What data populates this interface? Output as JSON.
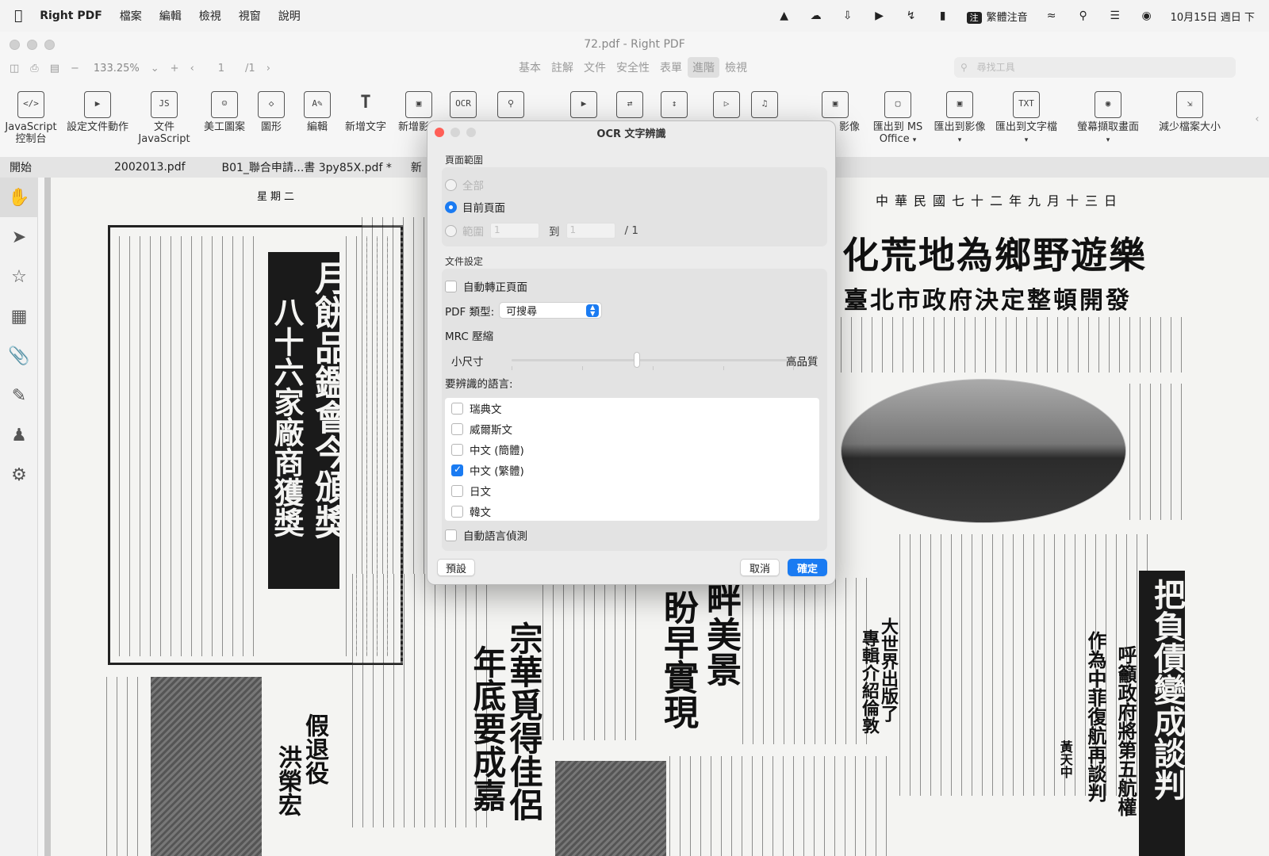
{
  "menubar": {
    "app_name": "Right PDF",
    "items": [
      "檔案",
      "編輯",
      "檢視",
      "視窗",
      "說明"
    ],
    "ime_badge": "注",
    "ime_name": "繁體注音",
    "clock": "10月15日 週日 下"
  },
  "window": {
    "title": "72.pdf - Right PDF",
    "zoom": "133.25%",
    "page_current": "1",
    "page_total": "/1",
    "search_placeholder": "尋找工具"
  },
  "mode_tabs": [
    {
      "label": "基本",
      "active": false
    },
    {
      "label": "註解",
      "active": false
    },
    {
      "label": "文件",
      "active": false
    },
    {
      "label": "安全性",
      "active": false
    },
    {
      "label": "表單",
      "active": false
    },
    {
      "label": "進階",
      "active": true
    },
    {
      "label": "檢視",
      "active": false
    }
  ],
  "ribbon": {
    "javascript_console": "JavaScript\n控制台",
    "set_doc_action": "設定文件動作",
    "doc_js": "文件\nJavaScript",
    "art_pattern": "美工圖案",
    "shape": "圖形",
    "edit": "編輯",
    "add_text": "新增文字",
    "add_image": "新增影像",
    "image_partial": "影像",
    "export_ms_office": "匯出到 MS\nOffice",
    "export_image": "匯出到影像",
    "export_text": "匯出到文字檔",
    "screen_capture": "螢幕擷取畫面",
    "reduce_size": "減少檔案大小",
    "ocr_badge": "OCR",
    "js_badge": "JS",
    "txt_badge": "TXT"
  },
  "doc_tabs": [
    "開始",
    "2002013.pdf",
    "B01_聯合申請...書 3py85X.pdf *",
    "新"
  ],
  "dialog": {
    "title": "OCR 文字辨識",
    "page_range_label": "頁面範圍",
    "opt_all": "全部",
    "opt_current": "目前頁面",
    "opt_range": "範圍",
    "range_from": "1",
    "range_to_word": "到",
    "range_to": "1",
    "range_total": "/ 1",
    "doc_settings_label": "文件設定",
    "auto_deskew": "自動轉正頁面",
    "pdf_type_label": "PDF 類型:",
    "pdf_type_value": "可搜尋",
    "mrc_label": "MRC 壓縮",
    "small_size": "小尺寸",
    "high_quality": "高品質",
    "languages_label": "要辨識的語言:",
    "languages": [
      {
        "name": "瑞典文",
        "checked": false
      },
      {
        "name": "威爾斯文",
        "checked": false
      },
      {
        "name": "中文 (簡體)",
        "checked": false
      },
      {
        "name": "中文 (繁體)",
        "checked": true
      },
      {
        "name": "日文",
        "checked": false
      },
      {
        "name": "韓文",
        "checked": false
      }
    ],
    "auto_lang_detect": "自動語言偵測",
    "default_button": "預設",
    "cancel_button": "取消",
    "ok_button": "確定"
  },
  "newspaper": {
    "date_line": "中華民國七十二年九月十三日",
    "page_no": "星期二",
    "headline_1": "化荒地為鄉野遊樂",
    "subhead_1": "臺北市政府決定整頓開發",
    "headline_2": "月餅品鑑會今頒獎",
    "subhead_2": "八十六家廠商獲獎",
    "headline_3": "把負債變成談判",
    "subhead_3": "呼籲政府將第五航權",
    "subhead_3b": "作為中菲復航再談判",
    "headline_4": "畔美景",
    "subhead_4": "盼早實現",
    "headline_5": "宗華覓得佳侶",
    "subhead_5": "年底要成嘉",
    "headline_6": "大世界出版了",
    "subhead_6": "專輯介紹倫敦",
    "headline_7": "假退役",
    "subhead_7": "洪榮宏",
    "byline": "黃天中"
  }
}
